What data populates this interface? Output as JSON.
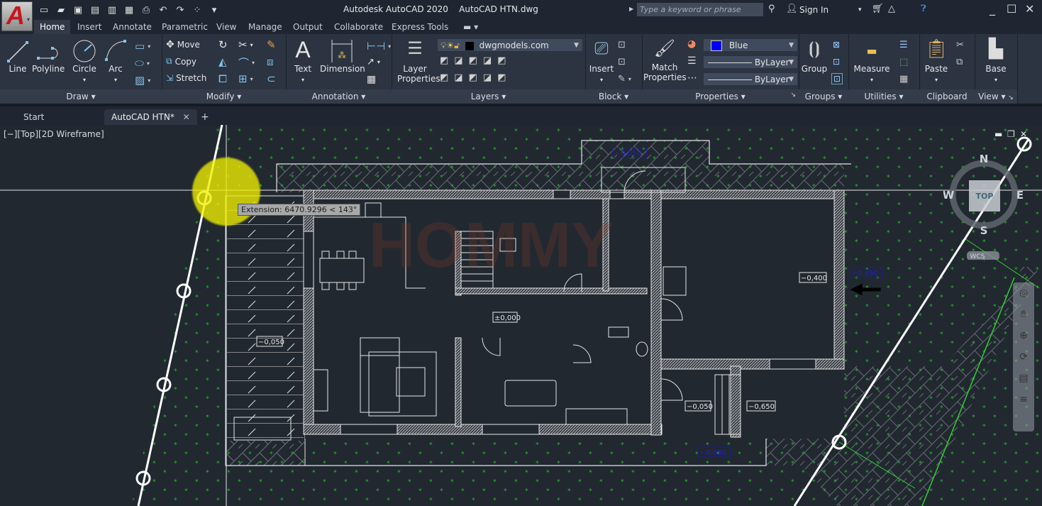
{
  "app": {
    "title": "Autodesk AutoCAD 2020    AutoCAD HTN.dwg",
    "app_button_letter": "A",
    "search_placeholder": "Type a keyword or phrase",
    "sign_in": "Sign In"
  },
  "quick_access": [
    {
      "icon": "new-icon",
      "glyph": "▭"
    },
    {
      "icon": "open-icon",
      "glyph": "▰"
    },
    {
      "icon": "save-icon",
      "glyph": "▣"
    },
    {
      "icon": "save-as-icon",
      "glyph": "▤"
    },
    {
      "icon": "open-from-web-icon",
      "glyph": "▥"
    },
    {
      "icon": "share-icon",
      "glyph": "▦"
    },
    {
      "icon": "plot-icon",
      "glyph": "⎙"
    },
    {
      "icon": "undo-icon",
      "glyph": "↶"
    },
    {
      "icon": "redo-icon",
      "glyph": "↷"
    },
    {
      "icon": "workspace-icon",
      "glyph": "⁘"
    },
    {
      "icon": "customize-icon",
      "glyph": "▾"
    }
  ],
  "ribbon_tabs": [
    "Home",
    "Insert",
    "Annotate",
    "Parametric",
    "View",
    "Manage",
    "Output",
    "Collaborate",
    "Express Tools"
  ],
  "active_tab": "Home",
  "panels": {
    "draw": {
      "title": "Draw",
      "buttons": [
        "Line",
        "Polyline",
        "Circle",
        "Arc"
      ]
    },
    "modify": {
      "title": "Modify",
      "buttons": [
        "Move",
        "Copy",
        "Stretch"
      ]
    },
    "annotation": {
      "title": "Annotation",
      "buttons": [
        "Text",
        "Dimension"
      ]
    },
    "layers": {
      "title": "Layers",
      "button": "Layer Properties",
      "current_layer": "dwgmodels.com"
    },
    "block": {
      "title": "Block",
      "button": "Insert"
    },
    "properties": {
      "title": "Properties",
      "button": "Match Properties",
      "color": "Blue",
      "linetype": "ByLayer",
      "lineweight": "ByLayer"
    },
    "groups": {
      "title": "Groups",
      "button": "Group"
    },
    "utilities": {
      "title": "Utilities",
      "button": "Measure"
    },
    "clipboard": {
      "title": "Clipboard",
      "button": "Paste"
    },
    "view": {
      "title": "View",
      "button": "Base"
    }
  },
  "doc_tabs": {
    "start": "Start",
    "active": "AutoCAD HTN*",
    "add": "+"
  },
  "viewport": {
    "label": "[−][Top][2D Wireframe]",
    "tooltip": "Extension: 6470.9296 < 143°",
    "viewcube": {
      "n": "N",
      "s": "S",
      "e": "E",
      "w": "W",
      "face": "TOP",
      "ucs": "WCS"
    },
    "watermark": "HOMMY",
    "elevations": [
      "−0,050",
      "−0,400",
      "−0,650",
      "±0,000",
      "−0,050",
      "−0,650",
      "−0,050",
      "−0,050"
    ]
  },
  "colors": {
    "accent_blue": "#0000ff",
    "plant_green": "#2bb52b",
    "cursor_yellow": "#f0f000",
    "bg": "#212830"
  }
}
